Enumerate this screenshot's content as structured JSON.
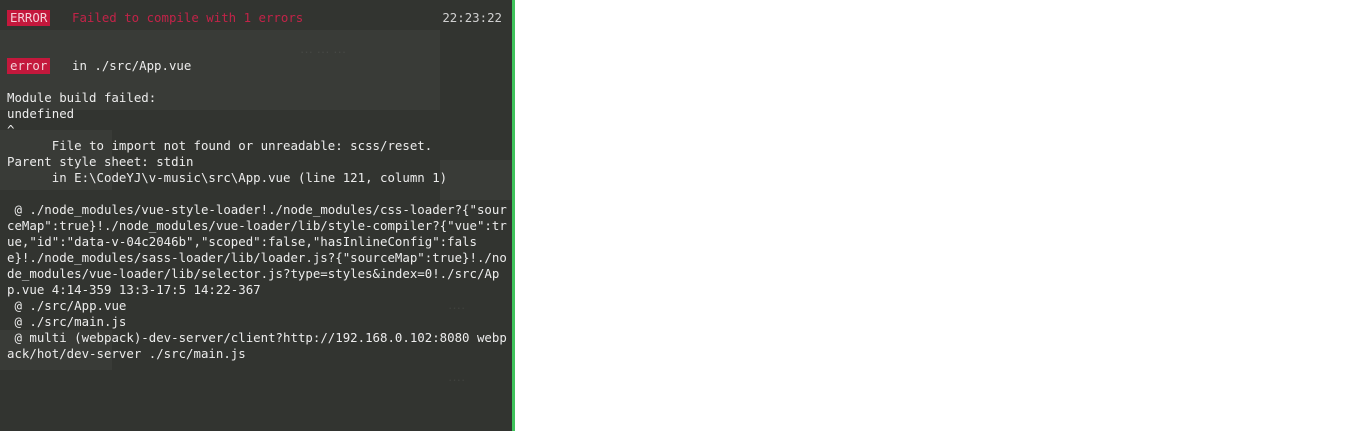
{
  "overlay": {
    "header": {
      "badge": "ERROR",
      "message": "Failed to compile with 1 errors",
      "time": "22:23:22"
    },
    "error": {
      "badge": "error",
      "location": "in ./src/App.vue"
    },
    "lines": [
      "Module build failed:",
      "undefined",
      "^",
      "      File to import not found or unreadable: scss/reset.",
      "Parent style sheet: stdin",
      "      in E:\\CodeYJ\\v-music\\src\\App.vue (line 121, column 1)",
      "",
      " @ ./node_modules/vue-style-loader!./node_modules/css-loader?{\"sourceMap\":true}!./node_modules/vue-loader/lib/style-compiler?{\"vue\":true,\"id\":\"data-v-04c2046b\",\"scoped\":false,\"hasInlineConfig\":false}!./node_modules/sass-loader/lib/loader.js?{\"sourceMap\":true}!./node_modules/vue-loader/lib/selector.js?type=styles&index=0!./src/App.vue 4:14-359 13:3-17:5 14:22-367",
      " @ ./src/App.vue",
      " @ ./src/main.js",
      " @ multi (webpack)-dev-server/client?http://192.168.0.102:8080 webpack/hot/dev-server ./src/main.js"
    ]
  },
  "colors": {
    "overlay_background": "#323430",
    "overlay_border": "#3fc35b",
    "error_badge": "#c4183c",
    "error_text": "#c22348"
  }
}
